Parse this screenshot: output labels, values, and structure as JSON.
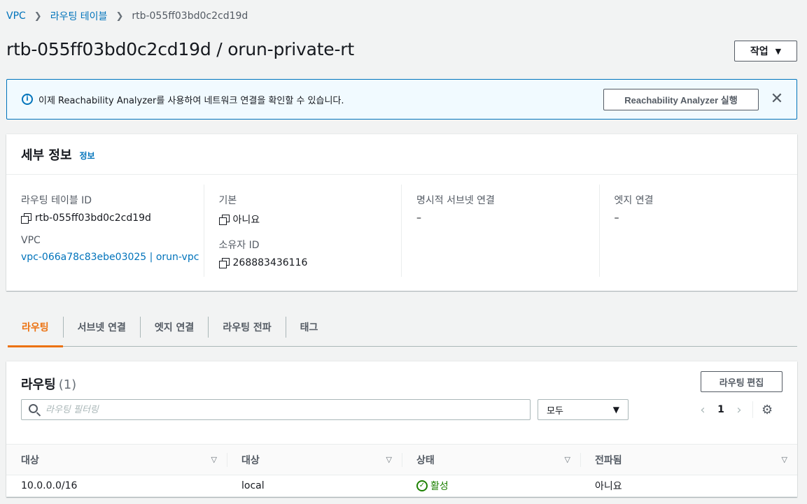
{
  "breadcrumb": {
    "items": [
      "VPC",
      "라우팅 테이블"
    ],
    "current": "rtb-055ff03bd0c2cd19d"
  },
  "page": {
    "title": "rtb-055ff03bd0c2cd19d / orun-private-rt",
    "actions_label": "작업"
  },
  "flash": {
    "message": "이제 Reachability Analyzer를 사용하여 네트워크 연결을 확인할 수 있습니다.",
    "button_label": "Reachability Analyzer 실행"
  },
  "details": {
    "title": "세부 정보",
    "info_link": "정보",
    "route_table_id_label": "라우팅 테이블 ID",
    "route_table_id": "rtb-055ff03bd0c2cd19d",
    "vpc_label": "VPC",
    "vpc_value": "vpc-066a78c83ebe03025 | orun-vpc",
    "main_label": "기본",
    "main_value": "아니요",
    "owner_label": "소유자 ID",
    "owner_value": "268883436116",
    "explicit_subnet_label": "명시적 서브넷 연결",
    "explicit_subnet_value": "–",
    "edge_label": "엣지 연결",
    "edge_value": "–"
  },
  "tabs": [
    "라우팅",
    "서브넷 연결",
    "엣지 연결",
    "라우팅 전파",
    "태그"
  ],
  "routes": {
    "title": "라우팅",
    "count": "(1)",
    "edit_label": "라우팅 편집",
    "search_placeholder": "라우팅 필터링",
    "filter_value": "모두",
    "page": "1",
    "columns": [
      "대상",
      "대상",
      "상태",
      "전파됨"
    ],
    "rows": [
      {
        "destination": "10.0.0.0/16",
        "target": "local",
        "status": "활성",
        "propagated": "아니요"
      }
    ]
  },
  "colors": {
    "link": "#0073bb",
    "accent": "#ec7211",
    "success": "#1d8102"
  }
}
